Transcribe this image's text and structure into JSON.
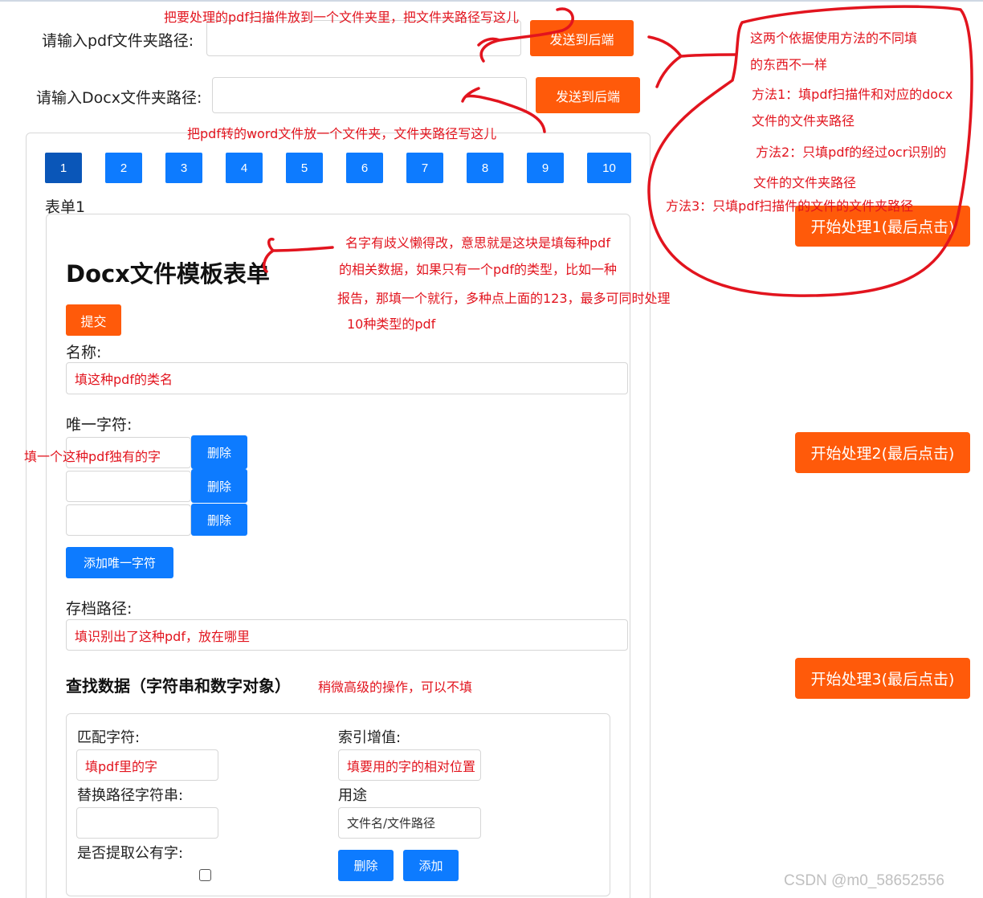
{
  "header": {
    "pdf_label": "请输入pdf文件夹路径:",
    "pdf_value": "",
    "pdf_send": "发送到后端",
    "docx_label": "请输入Docx文件夹路径:",
    "docx_value": "",
    "docx_send": "发送到后端"
  },
  "pagination": {
    "pages": [
      "1",
      "2",
      "3",
      "4",
      "5",
      "6",
      "7",
      "8",
      "9",
      "10"
    ],
    "active": "1"
  },
  "form": {
    "tab_title": "表单1",
    "heading": "Docx文件模板表单",
    "submit": "提交",
    "name_label": "名称:",
    "name_value": "填这种pdf的类名",
    "unique_label": "唯一字符:",
    "unique_rows": [
      {
        "value": "",
        "delete": "删除"
      },
      {
        "value": "",
        "delete": "删除"
      },
      {
        "value": "",
        "delete": "删除"
      }
    ],
    "add_unique": "添加唯一字符",
    "archive_label": "存档路径:",
    "archive_value": "填识别出了这种pdf，放在哪里",
    "search_heading": "查找数据（字符串和数字对象）",
    "match_label": "匹配字符:",
    "match_value": "填pdf里的字",
    "index_label": "索引增值:",
    "index_value": "填要用的字的相对位置",
    "replace_label": "替换路径字符串:",
    "replace_value": "",
    "usage_label": "用途",
    "usage_value": "文件名/文件路径",
    "common_label": "是否提取公有字:",
    "common_checked": false,
    "delete": "删除",
    "add": "添加"
  },
  "process": {
    "btn1": "开始处理1(最后点击)",
    "btn2": "开始处理2(最后点击)",
    "btn3": "开始处理3(最后点击)"
  },
  "annotations": {
    "top": "把要处理的pdf扫描件放到一个文件夹里，把文件夹路径写这儿",
    "word": "把pdf转的word文件放一个文件夹，文件夹路径写这儿",
    "method_intro_1": "这两个依据使用方法的不同填",
    "method_intro_2": "的东西不一样",
    "method1_1": "方法1：填pdf扫描件和对应的docx",
    "method1_2": "文件的文件夹路径",
    "method2_1": "方法2：只填pdf的经过ocr识别的",
    "method2_2": "文件的文件夹路径",
    "method3": "方法3：只填pdf扫描件的文件的文件夹路径",
    "name_1": "名字有歧义懒得改，意思就是这块是填每种pdf",
    "name_2": "的相关数据，如果只有一个pdf的类型，比如一种",
    "name_3": "报告，那填一个就行，多种点上面的123，最多可同时处理",
    "name_4": "10种类型的pdf",
    "unique": "填一个这种pdf独有的字",
    "advanced": "稍微高级的操作，可以不填"
  },
  "watermark": "CSDN @m0_58652556",
  "colors": {
    "orange": "#ff5a0a",
    "blue": "#0d7bff",
    "active_page": "#0a56b8",
    "annotation": "#e2141e"
  }
}
